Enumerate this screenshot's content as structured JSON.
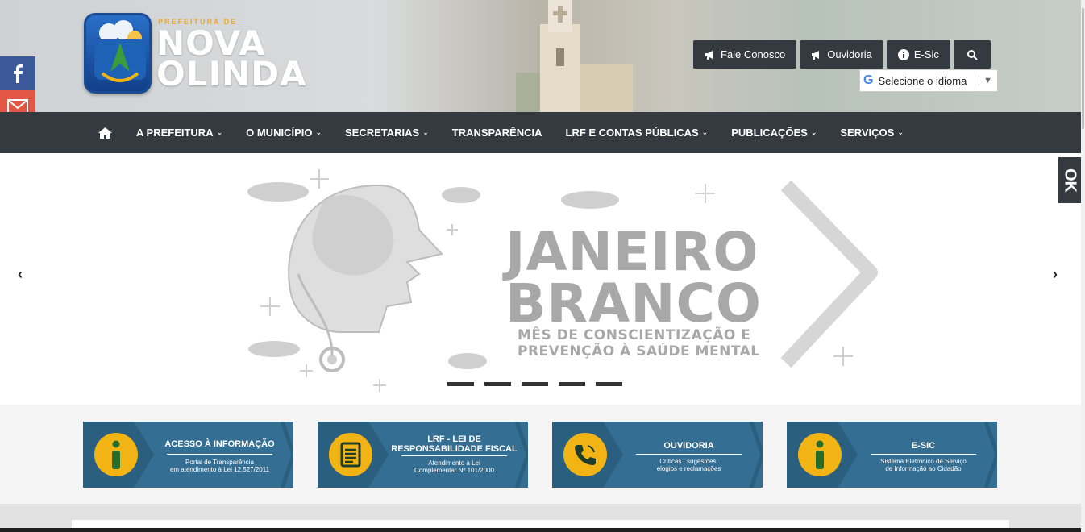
{
  "header": {
    "logo_small": "PREFEITURA DE",
    "logo_line1": "NOVA",
    "logo_line2": "OLINDA",
    "buttons": [
      {
        "label": "Fale Conosco",
        "icon": "megaphone-icon"
      },
      {
        "label": "Ouvidoria",
        "icon": "megaphone-icon"
      },
      {
        "label": "E-Sic",
        "icon": "info-icon"
      },
      {
        "label": "",
        "icon": "search-icon"
      }
    ],
    "translate_label": "Selecione o idioma"
  },
  "nav": {
    "items": [
      {
        "label": "A PREFEITURA",
        "caret": true
      },
      {
        "label": "O MUNICÍPIO",
        "caret": true
      },
      {
        "label": "SECRETARIAS",
        "caret": true
      },
      {
        "label": "TRANSPARÊNCIA",
        "caret": false
      },
      {
        "label": "LRF E CONTAS PÚBLICAS",
        "caret": true
      },
      {
        "label": "PUBLICAÇÕES",
        "caret": true
      },
      {
        "label": "SERVIÇOS",
        "caret": true
      }
    ]
  },
  "slider": {
    "title_line1": "JANEIRO",
    "title_line2": "BRANCO",
    "subtitle_line1": "MÊS DE CONSCIENTIZAÇÃO E",
    "subtitle_line2": "PREVENÇÃO À SAÚDE MENTAL",
    "prev_arrow": "‹",
    "next_arrow": "›",
    "dot_count": 5
  },
  "side_tab": "OK",
  "cards": [
    {
      "title": "ACESSO À INFORMAÇÃO",
      "sub1": "Portal de Transparência",
      "sub2": "em atendimento à Lei 12.527/2011",
      "icon": "info-icon"
    },
    {
      "title": "LRF - LEI DE RESPONSABILIDADE FISCAL",
      "sub1": "Atendimento à Lei",
      "sub2": "Complementar Nº 101/2000",
      "icon": "document-icon"
    },
    {
      "title": "OUVIDORIA",
      "sub1": "Críticas , sugestões,",
      "sub2": "elogios e reclamações",
      "icon": "phone-icon"
    },
    {
      "title": "E-SIC",
      "sub1": "Sistema Eletrônico de Serviço",
      "sub2": "de Informação ao Cidadão",
      "icon": "info-icon"
    }
  ],
  "colors": {
    "nav_bg": "#343a40",
    "card_bg": "#346e92",
    "card_icon_bg": "#f2b414",
    "facebook": "#3b5998",
    "mail": "#e15743",
    "instagram": "#d7447c"
  }
}
